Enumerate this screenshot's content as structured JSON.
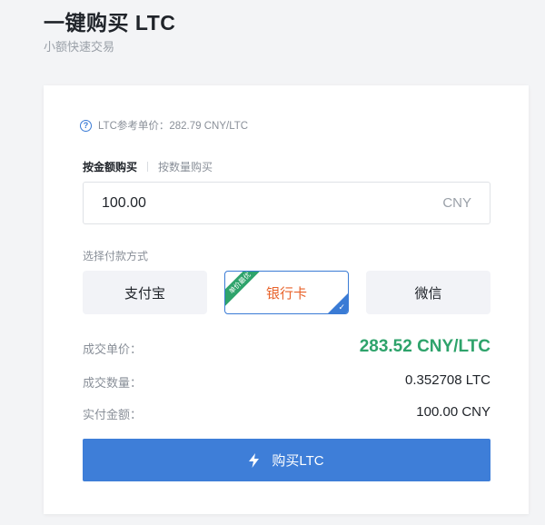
{
  "header": {
    "title": "一键购买 LTC",
    "subtitle": "小额快速交易"
  },
  "reference": {
    "text": "LTC参考单价：282.79 CNY/LTC",
    "icon": "help-icon"
  },
  "tabs": [
    {
      "label": "按金额购买",
      "active": true
    },
    {
      "label": "按数量购买",
      "active": false
    }
  ],
  "amount": {
    "value": "100.00",
    "unit": "CNY"
  },
  "payment": {
    "label": "选择付款方式",
    "options": [
      {
        "label": "支付宝",
        "selected": false
      },
      {
        "label": "银行卡",
        "selected": true,
        "badge": "单价最优"
      },
      {
        "label": "微信",
        "selected": false
      }
    ]
  },
  "summary": {
    "unit_price_label": "成交单价：",
    "unit_price_value": "283.52 CNY/LTC",
    "quantity_label": "成交数量：",
    "quantity_value": "0.352708 LTC",
    "total_label": "实付金额：",
    "total_value": "100.00 CNY"
  },
  "buy_button": {
    "label": "购买LTC",
    "icon": "lightning-icon"
  },
  "colors": {
    "accent": "#3e7ed8",
    "price_green": "#2ea36b",
    "bank_orange": "#e8622a"
  }
}
